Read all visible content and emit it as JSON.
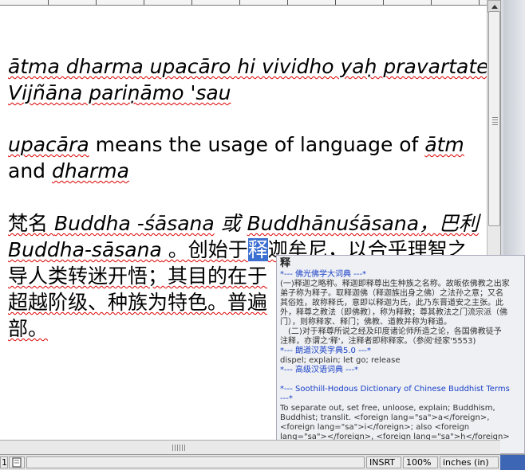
{
  "document": {
    "line1": "ātma dharma upacāro hi vividho yaḥ pravartate",
    "line2": "Vijñāna pariṇāmo 'sau",
    "line3_upacara": "upacāra",
    "line3_rest": " means the usage of language of ",
    "line3_atm": "ātm",
    "line4_and": "and ",
    "line4_dharma": "dharma",
    "line5_a": "梵名 ",
    "line5_buddha": "Buddha -śāsana",
    "line5_b": " 或 ",
    "line5_bs": "Buddhānuśāsana",
    "line5_c": "，巴利",
    "line6_bs": "Buddha-sāsana",
    "line6_a": " 。创始于",
    "line6_sel": "释",
    "line6_b": "迦牟尼，以合乎理智之",
    "line7": "导人类转迷开悟；其目的在于",
    "line8": "超越阶级、种族为特色。普遍",
    "line9": "部。"
  },
  "popup": {
    "headword": "释",
    "source1": "*--- 佛光佛学大词典 ---*",
    "body1": [
      "(一)释迦之略称。释迦即释尊出生种族之名称。故皈依佛教之出家",
      "弟子称为释子。取释迦佛（释迦族出身之佛）之法孙之意；又名",
      "其俗姓，故称释氏，意即以释迦为氏，此乃东晋道安之主张。此",
      "外，释尊之教法（即佛教），称为释教；尊其教法之门流宗派（佛",
      "门），则称释家、释门；佛教、道教并称为释道。",
      "　(二)对于释尊所说之经及印度诸论师所造之论，各国佛教徒予",
      "注释，亦谓之'释'，注释者即称释家。（参阅'经家'5553)"
    ],
    "source2": "*--- 朗道汉英字典5.0 ---*",
    "body2": "dispel; explain; let go; release",
    "source3": "*--- 高级汉语词典 ---*",
    "source4a": "*--- Soothill-Hodous Dictionary of Chinese Buddhist Terms",
    "source4b": "---*",
    "body4": [
      "To separate out, set free, unloose, explain; Buddhism,",
      "Buddhist; translit. <foreign lang=\"sa\">a</foreign>,",
      "<foreign lang=\"sa\">i</foreign>; also <foreign",
      "lang=\"sa\"></foreign>, <foreign lang=\"sa\">h</foreign>"
    ]
  },
  "status": {
    "left_number": "1",
    "insert_mode": "INSRT",
    "zoom": "100%",
    "units": "inches (in)"
  },
  "colors": {
    "selection": "#3b6fd0",
    "popup_source": "#1a40c8",
    "spell_squiggle": "#d00000"
  }
}
